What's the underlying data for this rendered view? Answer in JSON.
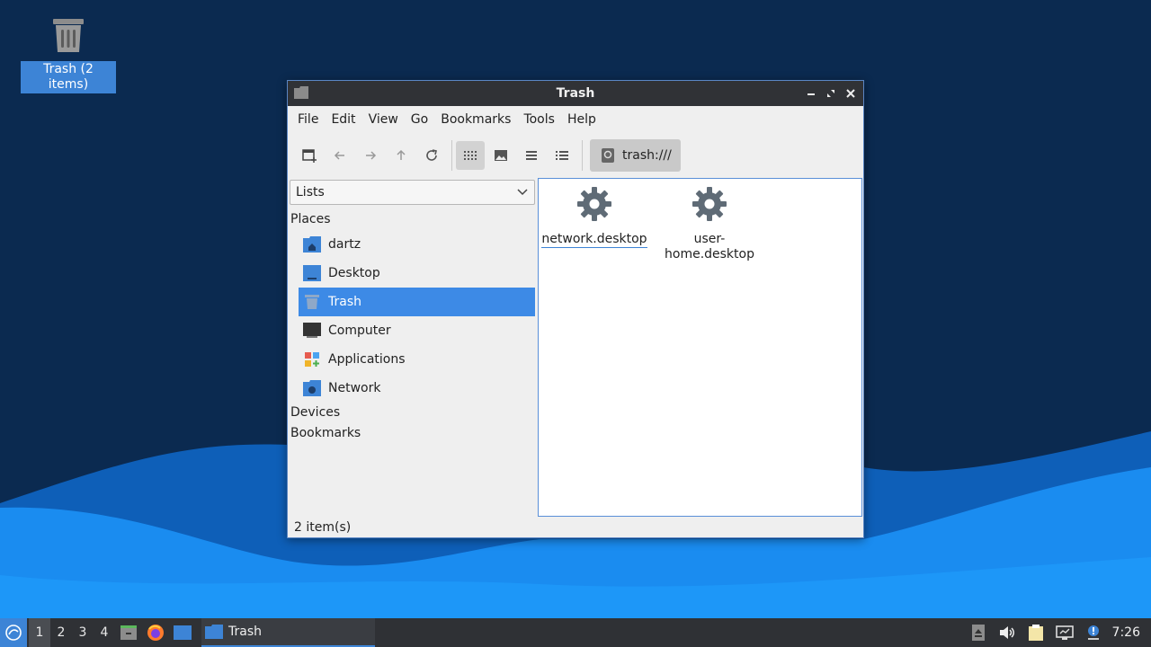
{
  "desktop": {
    "trash_icon_label": "Trash (2 items)"
  },
  "window": {
    "title": "Trash",
    "menu": [
      "File",
      "Edit",
      "View",
      "Go",
      "Bookmarks",
      "Tools",
      "Help"
    ],
    "path": "trash:///",
    "sidebar": {
      "mode": "Lists",
      "places_header": "Places",
      "places": [
        "dartz",
        "Desktop",
        "Trash",
        "Computer",
        "Applications",
        "Network"
      ],
      "selected_place": "Trash",
      "devices_header": "Devices",
      "bookmarks_header": "Bookmarks"
    },
    "files": [
      {
        "name": "network.desktop"
      },
      {
        "name": "user-home.desktop",
        "line1": "user-",
        "line2": "home.desktop"
      }
    ],
    "status": "2 item(s)"
  },
  "panel": {
    "workspaces": [
      "1",
      "2",
      "3",
      "4"
    ],
    "active_workspace": "1",
    "task_label": "Trash",
    "clock": "7:26"
  },
  "colors": {
    "accent": "#3d8ae6",
    "panel_bg": "#2f3135",
    "desktop_bg": "#0b2a50",
    "wave": "#1a8cf0"
  }
}
